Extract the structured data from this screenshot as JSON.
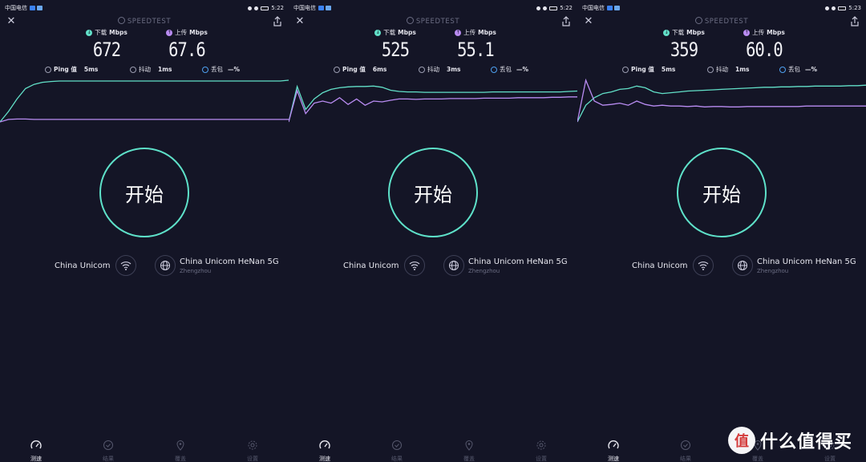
{
  "colors": {
    "background": "#141526",
    "download": "#62e0c8",
    "upload": "#b98cf2",
    "start_ring": "#5ee1c9",
    "loss": "#4ea0f0"
  },
  "panels": [
    {
      "status": {
        "carrier": "中国电信",
        "time": "5:22"
      },
      "brand": "SPEEDTEST",
      "download": {
        "label": "下载",
        "unit": "Mbps",
        "value": "672"
      },
      "upload": {
        "label": "上传",
        "unit": "Mbps",
        "value": "67.6"
      },
      "ping": {
        "label": "Ping 值",
        "value": "5ms"
      },
      "jitter": {
        "label": "抖动",
        "value": "1ms"
      },
      "loss": {
        "label": "丢包",
        "value": "—%"
      },
      "start_label": "开始",
      "isp": "China Unicom",
      "server": {
        "name": "China Unicom HeNan 5G",
        "location": "Zhengzhou"
      },
      "tabs": [
        {
          "label": "测速",
          "icon": "speedometer-icon"
        },
        {
          "label": "结果",
          "icon": "check-circle-icon"
        },
        {
          "label": "覆盖",
          "icon": "map-pin-icon"
        },
        {
          "label": "设置",
          "icon": "gear-icon"
        }
      ],
      "chart_data": {
        "type": "line",
        "series": [
          {
            "color": "#62e0c8",
            "values": [
              0,
              0.25,
              0.55,
              0.8,
              0.9,
              0.95,
              0.97,
              0.98,
              0.98,
              0.98,
              0.98,
              0.98,
              0.98,
              0.98,
              0.98,
              0.98,
              0.98,
              0.98,
              0.98,
              0.98,
              0.98,
              0.98,
              0.98,
              0.98,
              0.98,
              0.98,
              0.98,
              0.98,
              0.98,
              0.98,
              0.98,
              0.98,
              0.98,
              0.98,
              1.0
            ]
          },
          {
            "color": "#b98cf2",
            "values": [
              0.0,
              0.06,
              0.07,
              0.07,
              0.06,
              0.06,
              0.06,
              0.06,
              0.06,
              0.06,
              0.06,
              0.06,
              0.06,
              0.06,
              0.06,
              0.06,
              0.06,
              0.06,
              0.06,
              0.06,
              0.06,
              0.06,
              0.06,
              0.06,
              0.06,
              0.06,
              0.06,
              0.06,
              0.06,
              0.06,
              0.06,
              0.06,
              0.06,
              0.06,
              0.06
            ]
          }
        ]
      }
    },
    {
      "status": {
        "carrier": "中国电信",
        "time": "5:22"
      },
      "brand": "SPEEDTEST",
      "download": {
        "label": "下载",
        "unit": "Mbps",
        "value": "525"
      },
      "upload": {
        "label": "上传",
        "unit": "Mbps",
        "value": "55.1"
      },
      "ping": {
        "label": "Ping 值",
        "value": "6ms"
      },
      "jitter": {
        "label": "抖动",
        "value": "3ms"
      },
      "loss": {
        "label": "丢包",
        "value": "—%"
      },
      "start_label": "开始",
      "isp": "China Unicom",
      "server": {
        "name": "China Unicom HeNan 5G",
        "location": "Zhengzhou"
      },
      "tabs": [
        {
          "label": "测速",
          "icon": "speedometer-icon"
        },
        {
          "label": "结果",
          "icon": "check-circle-icon"
        },
        {
          "label": "覆盖",
          "icon": "map-pin-icon"
        },
        {
          "label": "设置",
          "icon": "gear-icon"
        }
      ],
      "chart_data": {
        "type": "line",
        "series": [
          {
            "color": "#62e0c8",
            "values": [
              0.0,
              0.85,
              0.3,
              0.55,
              0.7,
              0.78,
              0.82,
              0.84,
              0.85,
              0.85,
              0.86,
              0.83,
              0.76,
              0.73,
              0.72,
              0.72,
              0.71,
              0.71,
              0.71,
              0.71,
              0.71,
              0.71,
              0.71,
              0.71,
              0.72,
              0.72,
              0.72,
              0.72,
              0.72,
              0.72,
              0.72,
              0.72,
              0.72,
              0.73,
              0.74
            ]
          },
          {
            "color": "#b98cf2",
            "values": [
              0.0,
              0.75,
              0.2,
              0.45,
              0.5,
              0.45,
              0.58,
              0.42,
              0.55,
              0.4,
              0.5,
              0.48,
              0.52,
              0.55,
              0.55,
              0.54,
              0.55,
              0.55,
              0.55,
              0.56,
              0.56,
              0.56,
              0.56,
              0.57,
              0.57,
              0.57,
              0.57,
              0.58,
              0.58,
              0.58,
              0.58,
              0.59,
              0.59,
              0.6,
              0.6
            ]
          }
        ]
      }
    },
    {
      "status": {
        "carrier": "中国电信",
        "time": "5:23"
      },
      "brand": "SPEEDTEST",
      "download": {
        "label": "下载",
        "unit": "Mbps",
        "value": "359"
      },
      "upload": {
        "label": "上传",
        "unit": "Mbps",
        "value": "60.0"
      },
      "ping": {
        "label": "Ping 值",
        "value": "5ms"
      },
      "jitter": {
        "label": "抖动",
        "value": "1ms"
      },
      "loss": {
        "label": "丢包",
        "value": "—%"
      },
      "start_label": "开始",
      "isp": "China Unicom",
      "server": {
        "name": "China Unicom HeNan 5G",
        "location": "Zhengzhou"
      },
      "tabs": [
        {
          "label": "测速",
          "icon": "speedometer-icon"
        },
        {
          "label": "结果",
          "icon": "check-circle-icon"
        },
        {
          "label": "覆盖",
          "icon": "map-pin-icon"
        },
        {
          "label": "设置",
          "icon": "gear-icon"
        }
      ],
      "chart_data": {
        "type": "line",
        "series": [
          {
            "color": "#62e0c8",
            "values": [
              0.0,
              0.4,
              0.58,
              0.68,
              0.72,
              0.78,
              0.8,
              0.86,
              0.82,
              0.72,
              0.68,
              0.7,
              0.72,
              0.74,
              0.75,
              0.76,
              0.77,
              0.78,
              0.79,
              0.8,
              0.81,
              0.82,
              0.83,
              0.83,
              0.84,
              0.84,
              0.85,
              0.85,
              0.86,
              0.86,
              0.86,
              0.86,
              0.87,
              0.87,
              0.88
            ]
          },
          {
            "color": "#b98cf2",
            "values": [
              0.0,
              1.0,
              0.5,
              0.4,
              0.42,
              0.45,
              0.4,
              0.5,
              0.42,
              0.38,
              0.4,
              0.38,
              0.38,
              0.37,
              0.38,
              0.36,
              0.37,
              0.37,
              0.36,
              0.36,
              0.37,
              0.37,
              0.37,
              0.37,
              0.37,
              0.37,
              0.37,
              0.38,
              0.38,
              0.38,
              0.38,
              0.38,
              0.38,
              0.38,
              0.38
            ]
          }
        ]
      }
    }
  ],
  "watermark": {
    "badge": "值",
    "text": "什么值得买"
  }
}
